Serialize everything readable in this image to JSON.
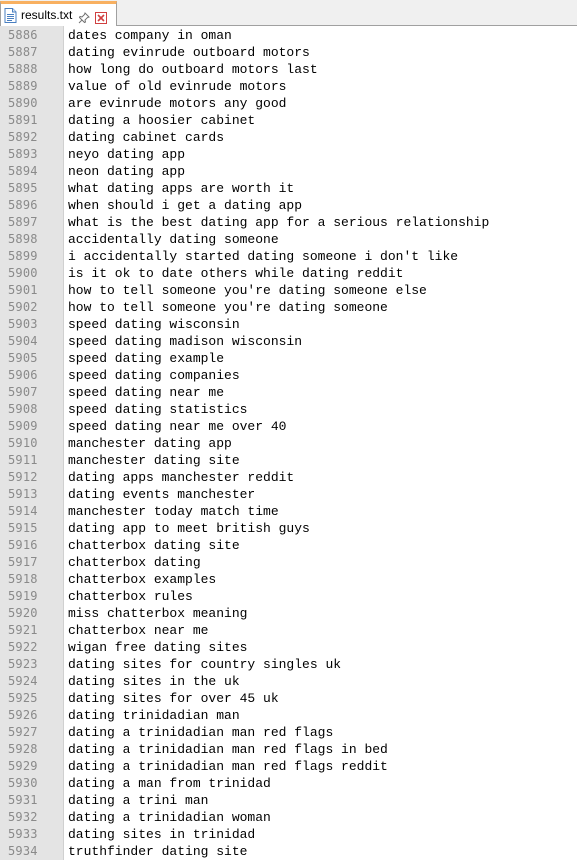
{
  "tab": {
    "title": "results.txt",
    "file_icon": "text-file-icon",
    "pin_icon": "pin-icon",
    "close_icon": "close-icon"
  },
  "colors": {
    "gutter_bg": "#e4e4e4",
    "line_number": "#8a8a8a",
    "active_tab_accent": "#f8b060",
    "close_icon": "#d04040"
  },
  "lines": [
    {
      "n": "5886",
      "text": "dates company in oman"
    },
    {
      "n": "5887",
      "text": "dating evinrude outboard motors"
    },
    {
      "n": "5888",
      "text": "how long do outboard motors last"
    },
    {
      "n": "5889",
      "text": "value of old evinrude motors"
    },
    {
      "n": "5890",
      "text": "are evinrude motors any good"
    },
    {
      "n": "5891",
      "text": "dating a hoosier cabinet"
    },
    {
      "n": "5892",
      "text": "dating cabinet cards"
    },
    {
      "n": "5893",
      "text": "neyo dating app"
    },
    {
      "n": "5894",
      "text": "neon dating app"
    },
    {
      "n": "5895",
      "text": "what dating apps are worth it"
    },
    {
      "n": "5896",
      "text": "when should i get a dating app"
    },
    {
      "n": "5897",
      "text": "what is the best dating app for a serious relationship"
    },
    {
      "n": "5898",
      "text": "accidentally dating someone"
    },
    {
      "n": "5899",
      "text": "i accidentally started dating someone i don't like"
    },
    {
      "n": "5900",
      "text": "is it ok to date others while dating reddit"
    },
    {
      "n": "5901",
      "text": "how to tell someone you're dating someone else"
    },
    {
      "n": "5902",
      "text": "how to tell someone you're dating someone"
    },
    {
      "n": "5903",
      "text": "speed dating wisconsin"
    },
    {
      "n": "5904",
      "text": "speed dating madison wisconsin"
    },
    {
      "n": "5905",
      "text": "speed dating example"
    },
    {
      "n": "5906",
      "text": "speed dating companies"
    },
    {
      "n": "5907",
      "text": "speed dating near me"
    },
    {
      "n": "5908",
      "text": "speed dating statistics"
    },
    {
      "n": "5909",
      "text": "speed dating near me over 40"
    },
    {
      "n": "5910",
      "text": "manchester dating app"
    },
    {
      "n": "5911",
      "text": "manchester dating site"
    },
    {
      "n": "5912",
      "text": "dating apps manchester reddit"
    },
    {
      "n": "5913",
      "text": "dating events manchester"
    },
    {
      "n": "5914",
      "text": "manchester today match time"
    },
    {
      "n": "5915",
      "text": "dating app to meet british guys"
    },
    {
      "n": "5916",
      "text": "chatterbox dating site"
    },
    {
      "n": "5917",
      "text": "chatterbox dating"
    },
    {
      "n": "5918",
      "text": "chatterbox examples"
    },
    {
      "n": "5919",
      "text": "chatterbox rules"
    },
    {
      "n": "5920",
      "text": "miss chatterbox meaning"
    },
    {
      "n": "5921",
      "text": "chatterbox near me"
    },
    {
      "n": "5922",
      "text": "wigan free dating sites"
    },
    {
      "n": "5923",
      "text": "dating sites for country singles uk"
    },
    {
      "n": "5924",
      "text": "dating sites in the uk"
    },
    {
      "n": "5925",
      "text": "dating sites for over 45 uk"
    },
    {
      "n": "5926",
      "text": "dating trinidadian man"
    },
    {
      "n": "5927",
      "text": "dating a trinidadian man red flags"
    },
    {
      "n": "5928",
      "text": "dating a trinidadian man red flags in bed"
    },
    {
      "n": "5929",
      "text": "dating a trinidadian man red flags reddit"
    },
    {
      "n": "5930",
      "text": "dating a man from trinidad"
    },
    {
      "n": "5931",
      "text": "dating a trini man"
    },
    {
      "n": "5932",
      "text": "dating a trinidadian woman"
    },
    {
      "n": "5933",
      "text": "dating sites in trinidad"
    },
    {
      "n": "5934",
      "text": "truthfinder dating site"
    }
  ]
}
